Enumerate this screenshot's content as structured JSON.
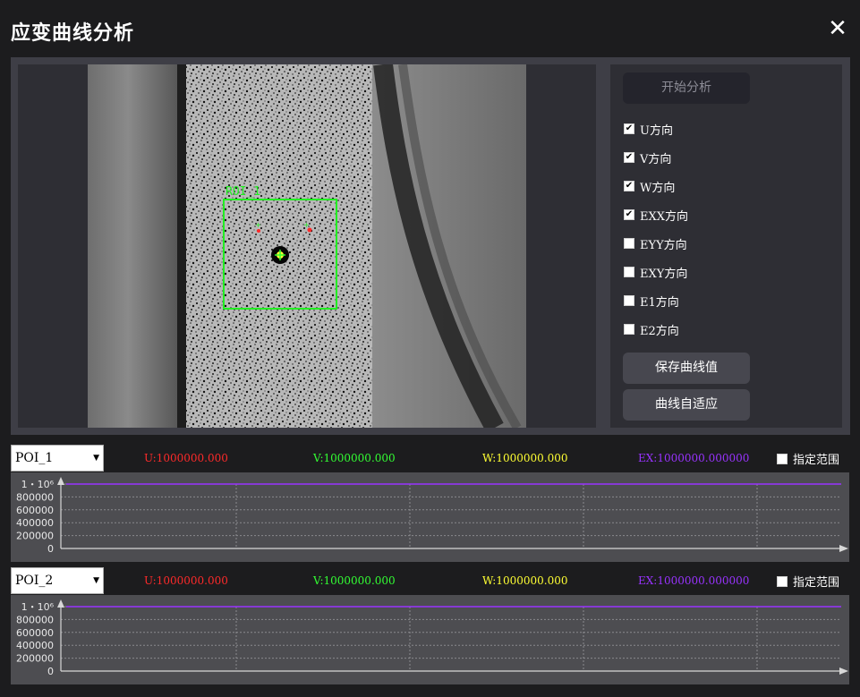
{
  "window": {
    "title": "应变曲线分析",
    "close_icon": "close-icon"
  },
  "viewer": {
    "roi_label": "ROI_1"
  },
  "panel": {
    "start_button": "开始分析",
    "checkboxes": [
      {
        "label": "U方向",
        "checked": true
      },
      {
        "label": "V方向",
        "checked": true
      },
      {
        "label": "W方向",
        "checked": true
      },
      {
        "label": "EXX方向",
        "checked": true
      },
      {
        "label": "EYY方向",
        "checked": false
      },
      {
        "label": "EXY方向",
        "checked": false
      },
      {
        "label": "E1方向",
        "checked": false
      },
      {
        "label": "E2方向",
        "checked": false
      }
    ],
    "save_button": "保存曲线值",
    "fit_button": "曲线自适应"
  },
  "curves": [
    {
      "poi": "POI_1",
      "u": "U:1000000.000",
      "v": "V:1000000.000",
      "w": "W:1000000.000",
      "ex": "EX:1000000.000000",
      "range_label": "指定范围"
    },
    {
      "poi": "POI_2",
      "u": "U:1000000.000",
      "v": "V:1000000.000",
      "w": "W:1000000.000",
      "ex": "EX:1000000.000000",
      "range_label": "指定范围"
    }
  ],
  "colors": {
    "u": "#ff2a2a",
    "v": "#33ff33",
    "w": "#ffff33",
    "ex": "#9933ff"
  },
  "chart_data": [
    {
      "type": "line",
      "y_tick_labels": [
        "1・10⁶",
        "800000",
        "600000",
        "400000",
        "200000",
        "0"
      ],
      "ylim": [
        0,
        1000000
      ],
      "grid": true,
      "series": [
        {
          "values": [
            1000000,
            1000000
          ]
        }
      ]
    },
    {
      "type": "line",
      "y_tick_labels": [
        "1・10⁶",
        "800000",
        "600000",
        "400000",
        "200000",
        "0"
      ],
      "ylim": [
        0,
        1000000
      ],
      "grid": true,
      "series": [
        {
          "values": [
            1000000,
            1000000
          ]
        }
      ]
    }
  ]
}
